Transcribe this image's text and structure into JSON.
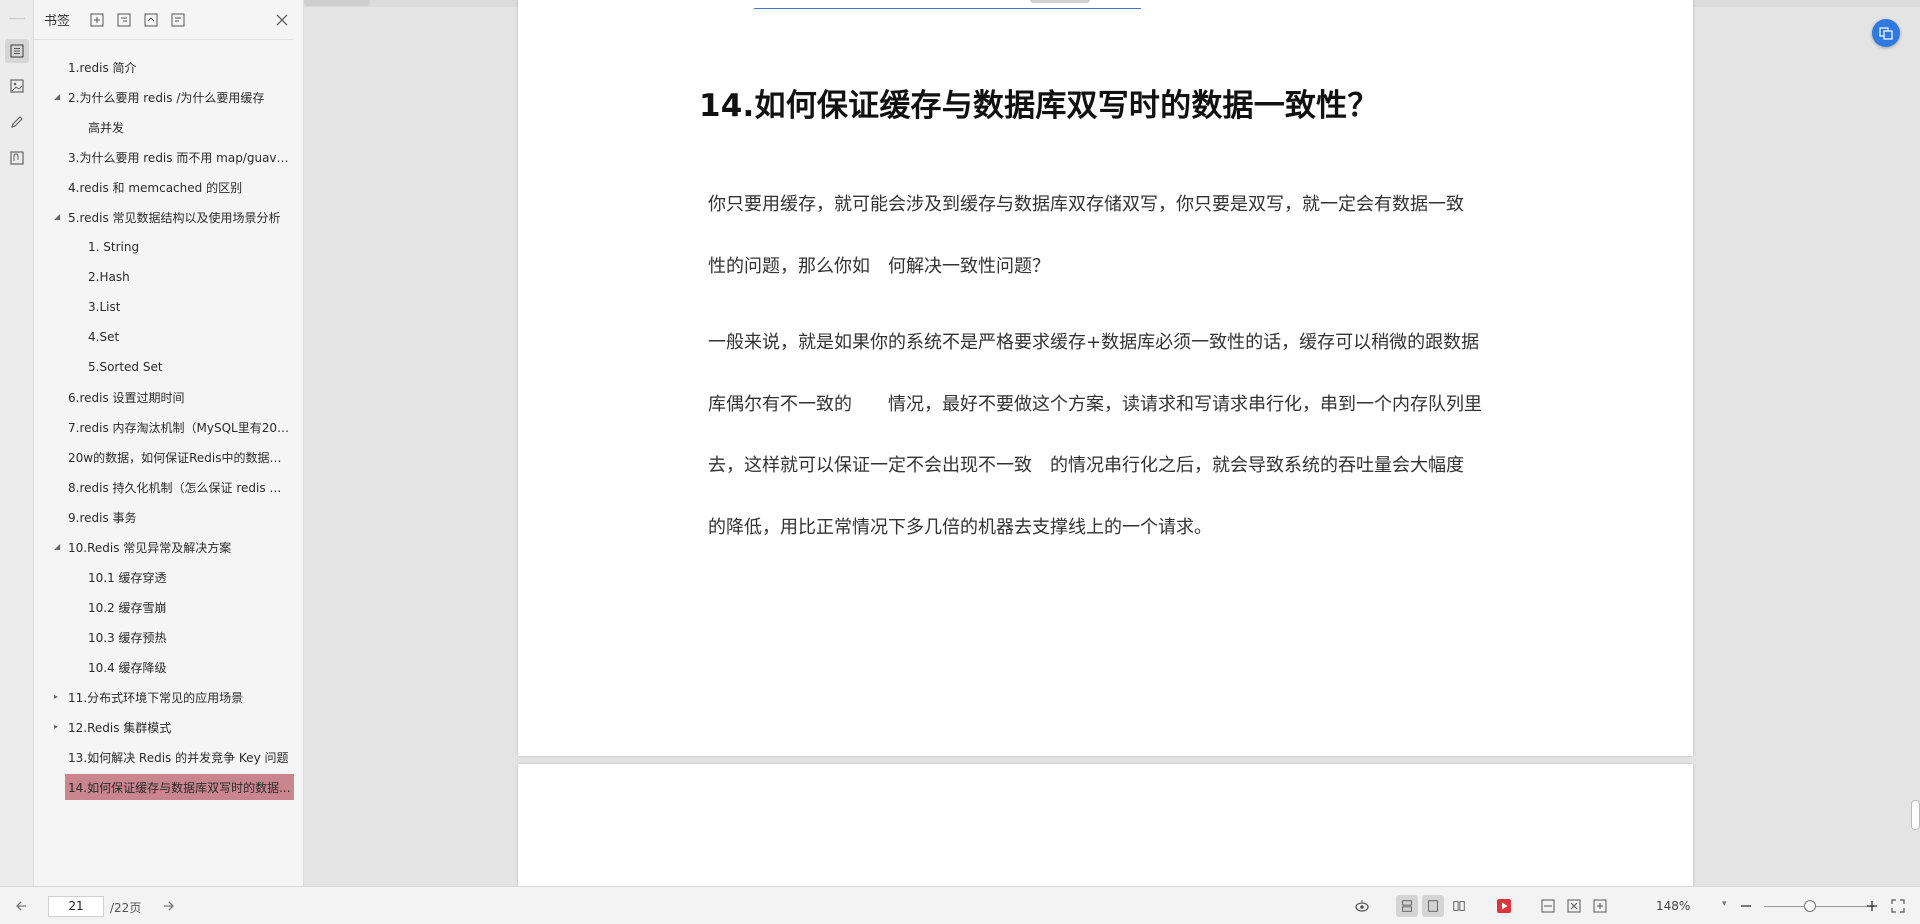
{
  "rail": {
    "icons": [
      "bookmark-list-icon",
      "thumbnail-icon",
      "annotation-icon",
      "attachment-icon"
    ]
  },
  "bookmarks": {
    "title": "书签",
    "toolbar_icons": [
      "add-bookmark-icon",
      "add-child-bookmark-icon",
      "expand-bookmark-icon",
      "bookmark-options-icon",
      "close-icon"
    ],
    "items": [
      {
        "label": "1.redis 简介",
        "level": 1,
        "toggle": ""
      },
      {
        "label": "2.为什么要用 redis /为什么要用缓存",
        "level": 1,
        "toggle": "◢"
      },
      {
        "label": "高并发",
        "level": 2,
        "toggle": ""
      },
      {
        "label": "3.为什么要用 redis 而不用 map/guava...",
        "level": 1,
        "toggle": ""
      },
      {
        "label": "4.redis 和 memcached 的区别",
        "level": 1,
        "toggle": ""
      },
      {
        "label": "5.redis 常见数据结构以及使用场景分析",
        "level": 1,
        "toggle": "◢"
      },
      {
        "label": "1. String",
        "level": 2,
        "toggle": ""
      },
      {
        "label": "2.Hash",
        "level": 2,
        "toggle": ""
      },
      {
        "label": "3.List",
        "level": 2,
        "toggle": ""
      },
      {
        "label": "4.Set",
        "level": 2,
        "toggle": ""
      },
      {
        "label": "5.Sorted Set",
        "level": 2,
        "toggle": ""
      },
      {
        "label": "6.redis 设置过期时间",
        "level": 1,
        "toggle": ""
      },
      {
        "label": "7.redis 内存淘汰机制（MySQL里有200...",
        "level": 1,
        "toggle": ""
      },
      {
        "label": "20w的数据，如何保证Redis中的数据都...",
        "level": 1,
        "toggle": ""
      },
      {
        "label": "8.redis 持久化机制（怎么保证 redis 挂...",
        "level": 1,
        "toggle": ""
      },
      {
        "label": "9.redis 事务",
        "level": 1,
        "toggle": ""
      },
      {
        "label": "10.Redis 常见异常及解决方案",
        "level": 1,
        "toggle": "◢"
      },
      {
        "label": "10.1 缓存穿透",
        "level": 2,
        "toggle": ""
      },
      {
        "label": "10.2 缓存雪崩",
        "level": 2,
        "toggle": ""
      },
      {
        "label": "10.3 缓存预热",
        "level": 2,
        "toggle": ""
      },
      {
        "label": "10.4 缓存降级",
        "level": 2,
        "toggle": ""
      },
      {
        "label": "11.分布式环境下常见的应用场景",
        "level": 1,
        "toggle": "▸"
      },
      {
        "label": "12.Redis 集群模式",
        "level": 1,
        "toggle": "▸"
      },
      {
        "label": "13.如何解决 Redis 的并发竞争 Key 问题",
        "level": 1,
        "toggle": ""
      },
      {
        "label": "14.如何保证缓存与数据库双写时的数据...",
        "level": 1,
        "toggle": "",
        "selected": true
      }
    ]
  },
  "document": {
    "heading": "14.如何保证缓存与数据库双写时的数据一致性？",
    "lines": [
      "你只要用缓存，就可能会涉及到缓存与数据库双存储双写，你只要是双写，就一定会有数据一致",
      "性的问题，那么你如　何解决一致性问题？",
      "一般来说，就是如果你的系统不是严格要求缓存+数据库必须一致性的话，缓存可以稍微的跟数据",
      "库偶尔有不一致的　　情况，最好不要做这个方案，读请求和写请求串行化，串到一个内存队列里",
      "去，这样就可以保证一定不会出现不一致　的情况串行化之后，就会导致系统的吞吐量会大幅度",
      "的降低，用比正常情况下多几倍的机器去支撑线上的一个请求。"
    ],
    "float_icon": "translate-icon"
  },
  "statusbar": {
    "current_page": "21",
    "total_pages": "/22页",
    "zoom": "148%",
    "icons": [
      "prev-page-icon",
      "next-page-icon",
      "eye-protection-icon",
      "single-page-icon",
      "continuous-page-icon",
      "double-page-icon",
      "play-icon",
      "fit-width-icon",
      "fit-page-icon",
      "actual-size-icon",
      "zoom-out-icon",
      "zoom-in-icon",
      "fullscreen-icon"
    ]
  },
  "colors": {
    "selected_bookmark": "#c9868e",
    "play_button": "#e0353b",
    "float_button": "#2f7ae0"
  }
}
